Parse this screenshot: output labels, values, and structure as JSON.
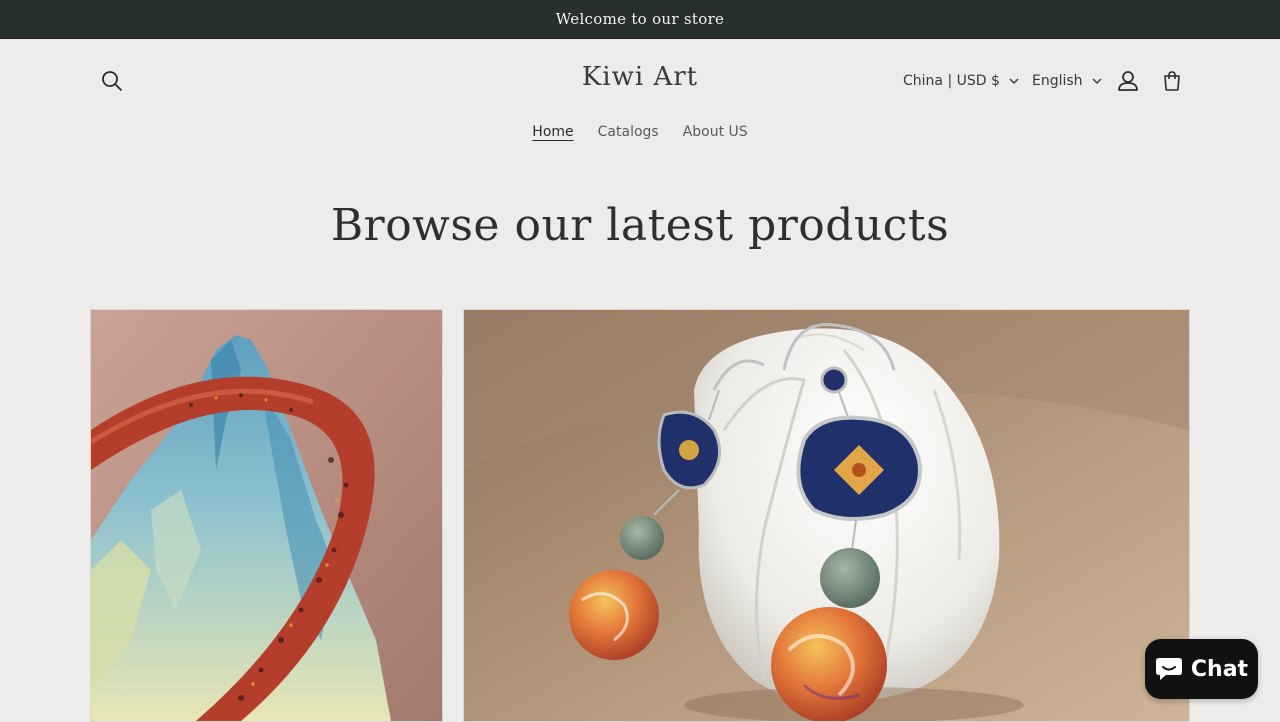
{
  "announcement": {
    "text": "Welcome to our store"
  },
  "header": {
    "logo": "Kiwi Art",
    "country_selector": "China | USD $",
    "language_selector": "English",
    "icons": {
      "search": "search-icon",
      "account": "account-icon",
      "cart": "cart-icon"
    }
  },
  "nav": {
    "items": [
      {
        "label": "Home",
        "active": true
      },
      {
        "label": "Catalogs",
        "active": false
      },
      {
        "label": "About US",
        "active": false
      }
    ]
  },
  "main": {
    "section_title": "Browse our latest products"
  },
  "chat": {
    "label": "Chat",
    "icon": "chat-bubble-icon",
    "accent": "#0f1211"
  },
  "colors": {
    "announcement_bg": "#27302c",
    "page_bg": "#edecea",
    "text": "#2b2b2b"
  }
}
